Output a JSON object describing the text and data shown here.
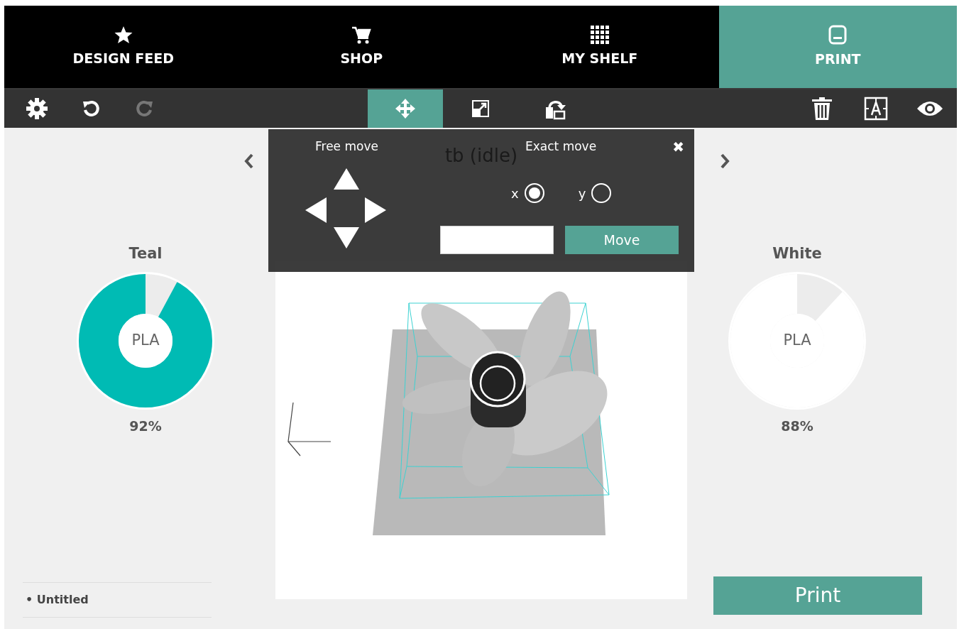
{
  "tabs": [
    {
      "label": "DESIGN FEED",
      "selected": false
    },
    {
      "label": "SHOP",
      "selected": false
    },
    {
      "label": "MY SHELF",
      "selected": false
    },
    {
      "label": "PRINT",
      "selected": true
    }
  ],
  "toolbar": {
    "left": [
      {
        "selected": false,
        "disabled": false
      },
      {
        "selected": false,
        "disabled": false
      },
      {
        "selected": false,
        "disabled": true
      }
    ],
    "center": [
      {
        "selected": true,
        "disabled": false
      },
      {
        "selected": false,
        "disabled": false
      },
      {
        "selected": false,
        "disabled": false
      }
    ],
    "right": [
      {
        "selected": false,
        "disabled": false
      },
      {
        "selected": false,
        "disabled": false
      },
      {
        "selected": false,
        "disabled": false
      }
    ]
  },
  "model_status": "tb (idle)",
  "move_panel": {
    "free_title": "Free move",
    "exact_title": "Exact move",
    "close": "✖",
    "axes": [
      {
        "label": "x",
        "selected": true
      },
      {
        "label": "y",
        "selected": false
      }
    ],
    "button": "Move"
  },
  "spools": [
    {
      "name": "Teal",
      "material": "PLA",
      "percent": "92%",
      "level": 0.92,
      "color": "#00bbb4"
    },
    {
      "name": "White",
      "material": "PLA",
      "percent": "88%",
      "level": 0.88,
      "color": "#ffffff"
    }
  ],
  "models": [
    "• Untitled"
  ],
  "print_button": "Print"
}
